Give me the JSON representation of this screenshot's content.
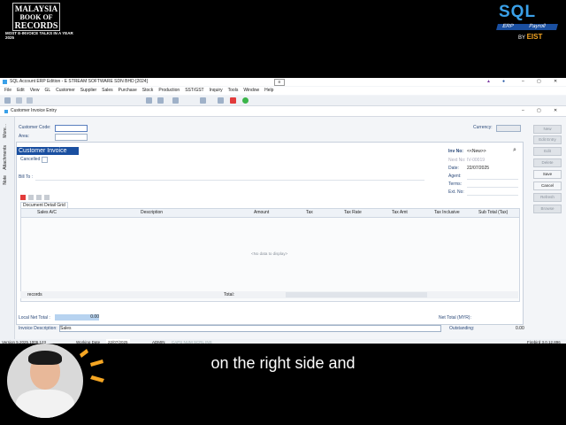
{
  "overlay": {
    "mbr_logo": {
      "line1": "MALAYSIA",
      "line2": "BOOK OF",
      "line3": "RECORDS"
    },
    "mbr_tagline": "MOST E-INVOICE TALKS IN A YEAR 2025",
    "sql_logo": {
      "title": "SQL",
      "erp": "ERP",
      "payroll": "Payroll",
      "by": "BY",
      "brand": "EIST"
    },
    "subtitle": "on the right side and"
  },
  "window": {
    "title": "SQL Account ERP Edition - E STREAM SOFTWARE SDN BHD [2024]",
    "controls": [
      "–",
      "▢",
      "✕"
    ]
  },
  "menu": [
    "File",
    "Edit",
    "View",
    "GL",
    "Customer",
    "Supplier",
    "Sales",
    "Purchase",
    "Stock",
    "Production",
    "SST/GST",
    "Inquiry",
    "Tools",
    "Window",
    "Help"
  ],
  "document": {
    "tab_title": "Customer Invoice Entry",
    "heading": "Customer Invoice",
    "customer_code_label": "Customer Code:",
    "area_label": "Area:",
    "currency_label": "Currency:",
    "cancelled_label": "Cancelled",
    "bill_to_label": "Bill To :",
    "grid_tab": "Document Detail Grid",
    "columns": [
      "Sales A/C",
      "Description",
      "Amount",
      "Tax",
      "Tax Rate",
      "Tax Amt",
      "Tax Inclusive",
      "Sub Total (Tax)"
    ],
    "empty_text": "<No data to display>",
    "records_label": "records",
    "total_label": "Total:",
    "local_net_total_label": "Local Net Total :",
    "local_net_total_value": "0.00",
    "net_total_label": "Net Total (MYR):",
    "invoice_description_label": "Invoice Description:",
    "invoice_description_value": "Sales",
    "outstanding_label": "Outstanding:",
    "outstanding_value": "0.00",
    "right_fields": [
      {
        "label": "Inv No:",
        "value": "<<New>>"
      },
      {
        "label": "Next No:",
        "value": "IV-00019"
      },
      {
        "label": "Date:",
        "value": "22/07/2025"
      },
      {
        "label": "Agent:",
        "value": ""
      },
      {
        "label": "Terms:",
        "value": ""
      },
      {
        "label": "Ext. No:",
        "value": ""
      }
    ],
    "side_tabs": [
      "More...",
      "Attachments",
      "Note"
    ]
  },
  "actions": [
    "New",
    "Edit Entry",
    "Edit",
    "Delete",
    "Save",
    "Cancel",
    "Refresh",
    "Browse"
  ],
  "status": {
    "version": "Version 5.2025.1006.123",
    "working_date_label": "Working Date",
    "working_date": "22/07/2025",
    "user": "ADMIN",
    "flags": "CAPS NUM SCRL INS",
    "db": "Firebird 3.0.12.896"
  }
}
